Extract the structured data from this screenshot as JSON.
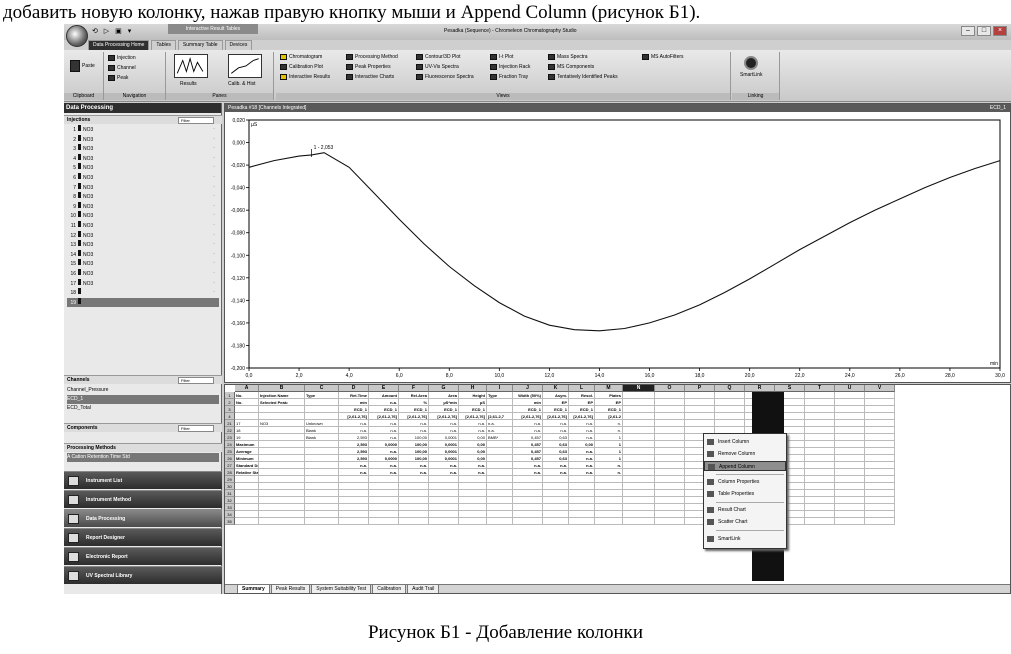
{
  "doc": {
    "top_text": "добавить новую колонку, нажав правую кнопку мыши и Append Column (рисунок Б1).",
    "caption": "Рисунок Б1 - Добавление колонки"
  },
  "window": {
    "title": "Pesadka (Sequence) - Chromeleon Chromatography Studio",
    "context_tab": "Interactive Result Tables",
    "tabs": [
      "Data Processing Home",
      "Tables",
      "Summary Table",
      "Devices"
    ]
  },
  "ribbon": {
    "groups": [
      "Clipboard",
      "Navigation",
      "Panes",
      "Views",
      "Linking"
    ],
    "clipboard": [
      "Paste"
    ],
    "navigation": [
      "Injection",
      "Channel",
      "Peak"
    ],
    "panes": [
      "Results",
      "Calib. & Hist"
    ],
    "views_col1": [
      "Chromatogram",
      "Calibration Plot",
      "Interactive Results"
    ],
    "views_col2": [
      "Processing Method",
      "Peak Properties",
      "Interactive Charts"
    ],
    "views_col3": [
      "Contour/3D Plot",
      "UV-Vis Spectra",
      "Fluorescence Spectra"
    ],
    "views_col4": [
      "I-t Plot",
      "Injection Rack",
      "Fraction Tray"
    ],
    "views_col5": [
      "Mass Spectra",
      "MS Components",
      "Tentatively Identified Peaks"
    ],
    "views_col6": [
      "MS AutoFilters"
    ],
    "linking": "SmartLink"
  },
  "left_panel": {
    "title": "Data Processing",
    "injections_label": "Injections",
    "filter_label": "Filter",
    "injections": [
      {
        "num": "1",
        "name": "NO3"
      },
      {
        "num": "2",
        "name": "NO3"
      },
      {
        "num": "3",
        "name": "NO3"
      },
      {
        "num": "4",
        "name": "NO3"
      },
      {
        "num": "5",
        "name": "NO3"
      },
      {
        "num": "6",
        "name": "NO3"
      },
      {
        "num": "7",
        "name": "NO3"
      },
      {
        "num": "8",
        "name": "NO3"
      },
      {
        "num": "9",
        "name": "NO3"
      },
      {
        "num": "10",
        "name": "NO3"
      },
      {
        "num": "11",
        "name": "NO3"
      },
      {
        "num": "12",
        "name": "NO3"
      },
      {
        "num": "13",
        "name": "NO3"
      },
      {
        "num": "14",
        "name": "NO3"
      },
      {
        "num": "15",
        "name": "NO3"
      },
      {
        "num": "16",
        "name": "NO3"
      },
      {
        "num": "17",
        "name": "NO3"
      },
      {
        "num": "18",
        "name": ""
      },
      {
        "num": "19",
        "name": ""
      }
    ],
    "channels_label": "Channels",
    "channels": [
      "Channel_Pressure",
      "ECD_1",
      "ECD_Total"
    ],
    "components_label": "Components",
    "processing_label": "Processing Methods",
    "processing_item": "A Cation Retention Time Std",
    "nav": [
      "Instrument List",
      "Instrument Method",
      "Data Processing",
      "Report Designer",
      "Electronic Report",
      "UV Spectral Library"
    ],
    "nav_active": "Data Processing"
  },
  "chart": {
    "window_title": "Pesadka #18 [Channels Integrated]",
    "channel_label": "ECD_1",
    "y_unit": "µS",
    "x_unit": "min",
    "peak_label": "1 - 2,053",
    "y_ticks": [
      "0,020",
      "0,000",
      "-0,020",
      "-0,040",
      "-0,060",
      "-0,080",
      "-0,100",
      "-0,120",
      "-0,140",
      "-0,160",
      "-0,180",
      "-0,200"
    ],
    "x_ticks": [
      "0,0",
      "2,0",
      "4,0",
      "6,0",
      "8,0",
      "10,0",
      "12,0",
      "14,0",
      "16,0",
      "18,0",
      "20,0",
      "22,0",
      "24,0",
      "26,0",
      "28,0",
      "30,0"
    ],
    "end_label": "30,0"
  },
  "chart_data": {
    "type": "line",
    "x": [
      0.0,
      1.0,
      2.0,
      2.5,
      3.0,
      4.0,
      5.0,
      6.0,
      7.0,
      8.0,
      9.0,
      10.0,
      11.0,
      12.0,
      13.0,
      14.0,
      15.0,
      16.0,
      17.0,
      18.0,
      19.0,
      20.0,
      21.0,
      22.0,
      23.0,
      24.0,
      25.0,
      26.0,
      27.0,
      28.0,
      29.0,
      30.0
    ],
    "y": [
      -0.022,
      -0.016,
      -0.012,
      -0.011,
      -0.009,
      -0.022,
      -0.045,
      -0.068,
      -0.09,
      -0.11,
      -0.127,
      -0.142,
      -0.154,
      -0.162,
      -0.166,
      -0.167,
      -0.165,
      -0.16,
      -0.153,
      -0.144,
      -0.133,
      -0.121,
      -0.108,
      -0.095,
      -0.083,
      -0.071,
      -0.06,
      -0.05,
      -0.04,
      -0.031,
      -0.023,
      -0.016
    ],
    "xlim": [
      0,
      30
    ],
    "ylim": [
      -0.2,
      0.02
    ],
    "xlabel": "min",
    "ylabel": "µS",
    "title": ""
  },
  "sheet": {
    "columns": [
      "A",
      "B",
      "C",
      "D",
      "E",
      "F",
      "G",
      "H",
      "I",
      "J",
      "K",
      "L",
      "M",
      "N",
      "O",
      "P",
      "Q",
      "R",
      "S",
      "T",
      "U",
      "V"
    ],
    "header_rows": [
      [
        "No.",
        "Injection Name",
        "Type",
        "Ret.Time",
        "Amount",
        "Rel.Area",
        "Area",
        "Height",
        "Type",
        "Width (50%)",
        "Asym.",
        "Resol.",
        "Plates"
      ],
      [
        "No.",
        "Selected Peak:",
        "",
        "min",
        "n.a.",
        "%",
        "µS*min",
        "µS",
        "",
        "min",
        "EP",
        "EP",
        "EP"
      ],
      [
        "",
        "",
        "",
        "ECD_1",
        "ECD_1",
        "ECD_1",
        "ECD_1",
        "ECD_1",
        "",
        "ECD_1",
        "ECD_1",
        "ECD_1",
        "ECD_1"
      ],
      [
        "",
        "",
        "",
        "[2,61-2,76]",
        "[2,61-2,76]",
        "[2,61-2,76]",
        "[2,61-2,76]",
        "[2,61-2,76]",
        "[2,61-2,7",
        "[2,61-2,76]",
        "[2,61-2,76]",
        "[2,61-2,76]",
        "[2,61-2"
      ]
    ],
    "data_rows": [
      {
        "row": "21",
        "cells": [
          "17",
          "NO3",
          "Unknown",
          "n.a.",
          "n.a.",
          "n.a.",
          "n.a.",
          "n.a.",
          "n.a.",
          "n.a.",
          "n.a.",
          "n.a.",
          "n."
        ]
      },
      {
        "row": "22",
        "cells": [
          "18",
          "",
          "Blank",
          "n.a.",
          "n.a.",
          "n.a.",
          "n.a.",
          "n.a.",
          "n.a.",
          "n.a.",
          "n.a.",
          "n.a.",
          "n."
        ]
      },
      {
        "row": "23",
        "cells": [
          "19",
          "",
          "Blank",
          "2,593",
          "n.a.",
          "100,00",
          "0,0001",
          "0,00",
          "BMB*",
          "0,457",
          "0,63",
          "n.a.",
          "1"
        ]
      },
      {
        "row": "24",
        "cells": [
          "Maximum",
          "",
          "",
          "2,593",
          "0,0000",
          "100,00",
          "0,0001",
          "0,00",
          "",
          "0,457",
          "0,63",
          "0,00",
          "1"
        ]
      },
      {
        "row": "25",
        "cells": [
          "Average",
          "",
          "",
          "2,593",
          "n.a.",
          "100,00",
          "0,0001",
          "0,00",
          "",
          "0,457",
          "0,63",
          "n.a.",
          "1"
        ]
      },
      {
        "row": "26",
        "cells": [
          "Minimum",
          "",
          "",
          "2,593",
          "0,0000",
          "100,00",
          "0,0001",
          "0,00",
          "",
          "0,457",
          "0,63",
          "n.a.",
          "1"
        ]
      },
      {
        "row": "27",
        "cells": [
          "Standard Deviation",
          "",
          "",
          "n.a.",
          "n.a.",
          "n.a.",
          "n.a.",
          "n.a.",
          "",
          "n.a.",
          "n.a.",
          "n.a.",
          "n."
        ]
      },
      {
        "row": "28",
        "cells": [
          "Relative Standard Deviation",
          "",
          "",
          "n.a.",
          "n.a.",
          "n.a.",
          "n.a.",
          "n.a.",
          "",
          "n.a.",
          "n.a.",
          "n.a.",
          "n."
        ]
      }
    ],
    "empty_rows": [
      "29",
      "30",
      "31",
      "32",
      "33",
      "34",
      "35"
    ],
    "header_row_nums": [
      "1",
      "2",
      "3",
      "4"
    ],
    "tabs": [
      "Summary",
      "Peak Results",
      "System Suitability Test",
      "Calibration",
      "Audit Trail"
    ]
  },
  "context_menu": {
    "items": [
      "Insert Column",
      "Remove Column",
      "Append Column",
      "Column Properties",
      "Table Properties",
      "Result Chart",
      "Scatter Chart",
      "SmartLink"
    ],
    "highlighted": "Append Column"
  }
}
